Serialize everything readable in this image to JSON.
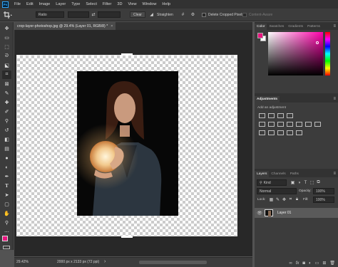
{
  "app": {
    "logo": "Ps",
    "menu": [
      "File",
      "Edit",
      "Image",
      "Layer",
      "Type",
      "Select",
      "Filter",
      "3D",
      "View",
      "Window",
      "Help"
    ]
  },
  "options_bar": {
    "ratio_select": "Ratio",
    "clear_label": "Clear",
    "straighten_label": "Straighten",
    "delete_cropped_label": "Delete Cropped Pixels",
    "content_aware_label": "Content-Aware"
  },
  "document": {
    "tab_title": "crop-layer-photoshop.jpg @ 29.4% (Layer 01, RGB/8) *",
    "close_glyph": "×"
  },
  "status_bar": {
    "zoom": "29.42%",
    "doc_info": "2000 px x 2133 px (72 ppi)",
    "arrow": "›"
  },
  "tools": [
    "move-tool",
    "artboard-tool",
    "marquee-tool",
    "lasso-tool",
    "object-select-tool",
    "crop-tool",
    "frame-tool",
    "eyedropper-tool",
    "spot-healing-tool",
    "brush-tool",
    "clone-stamp-tool",
    "history-brush-tool",
    "eraser-tool",
    "gradient-tool",
    "blur-tool",
    "dodge-tool",
    "pen-tool",
    "type-tool",
    "path-select-tool",
    "rectangle-tool",
    "hand-tool",
    "zoom-tool",
    "more-tools"
  ],
  "colors": {
    "foreground": "#e8157f",
    "background": "#ffffff",
    "picker_hue": "#ff00aa"
  },
  "color_panel": {
    "tabs": [
      "Color",
      "Swatches",
      "Gradients",
      "Patterns"
    ],
    "active_tab": "Color"
  },
  "adjustments_panel": {
    "title": "Adjustments",
    "subtitle": "Add an adjustment"
  },
  "layers_panel": {
    "tabs": [
      "Layers",
      "Channels",
      "Paths"
    ],
    "kind_filter": "Kind",
    "blend_mode": "Normal",
    "opacity_label": "Opacity:",
    "opacity_value": "100%",
    "lock_label": "Lock:",
    "fill_label": "Fill:",
    "fill_value": "100%",
    "layers": [
      {
        "name": "Layer 01",
        "visible": true
      }
    ]
  }
}
